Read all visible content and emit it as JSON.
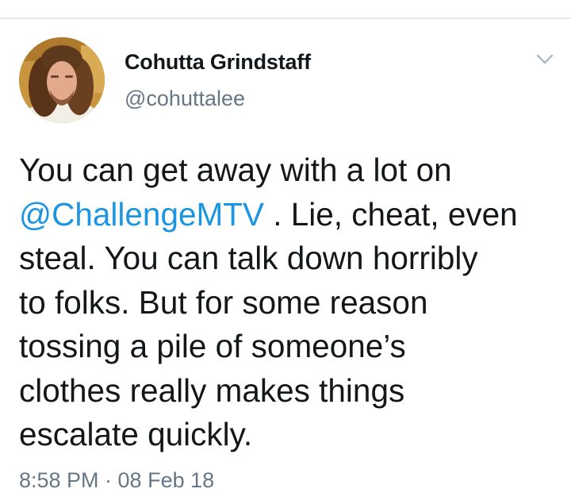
{
  "author": {
    "display_name": "Cohutta Grindstaff",
    "handle": "@cohuttalee"
  },
  "menu": {
    "icon": "chevron-down-icon"
  },
  "tweet": {
    "line1": "You can get away with a lot on",
    "mention": "@ChallengeMTV",
    "line2_rest": " . Lie, cheat, even",
    "line3": "steal. You can talk down horribly",
    "line4": "to folks. But for some reason",
    "line5": "tossing a pile of someone’s",
    "line6": "clothes really makes things",
    "line7": "escalate quickly."
  },
  "meta": {
    "timestamp": "8:58 PM · 08 Feb 18"
  },
  "colors": {
    "text": "#14171a",
    "secondary": "#657786",
    "link": "#1b95e0",
    "border": "#e3e8ec"
  }
}
